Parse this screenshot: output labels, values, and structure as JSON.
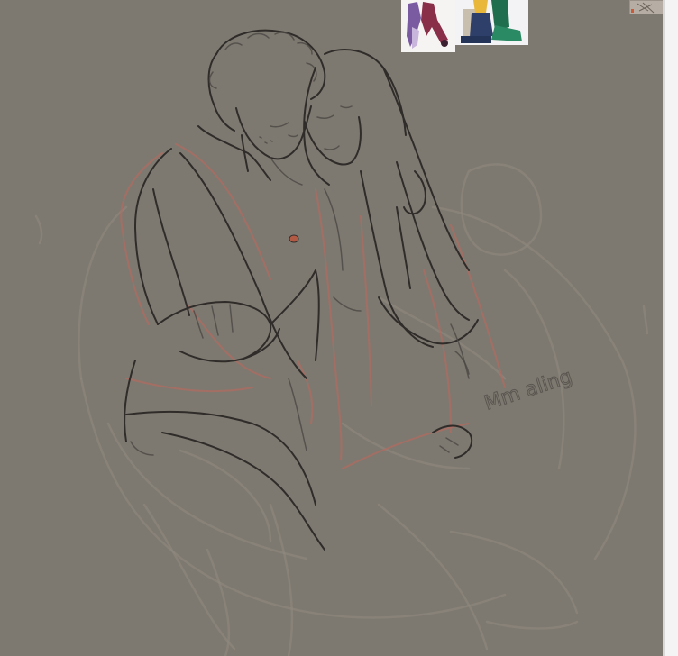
{
  "canvas": {
    "background_color": "#7e7970",
    "sketch_colors": {
      "lineart": "#2f2c2a",
      "construction": "#b06b60",
      "rough": "#8f8a82"
    }
  },
  "references": [
    {
      "label": "reference-image-1"
    },
    {
      "label": "reference-image-2"
    }
  ],
  "sketch_text": "Mm aling"
}
